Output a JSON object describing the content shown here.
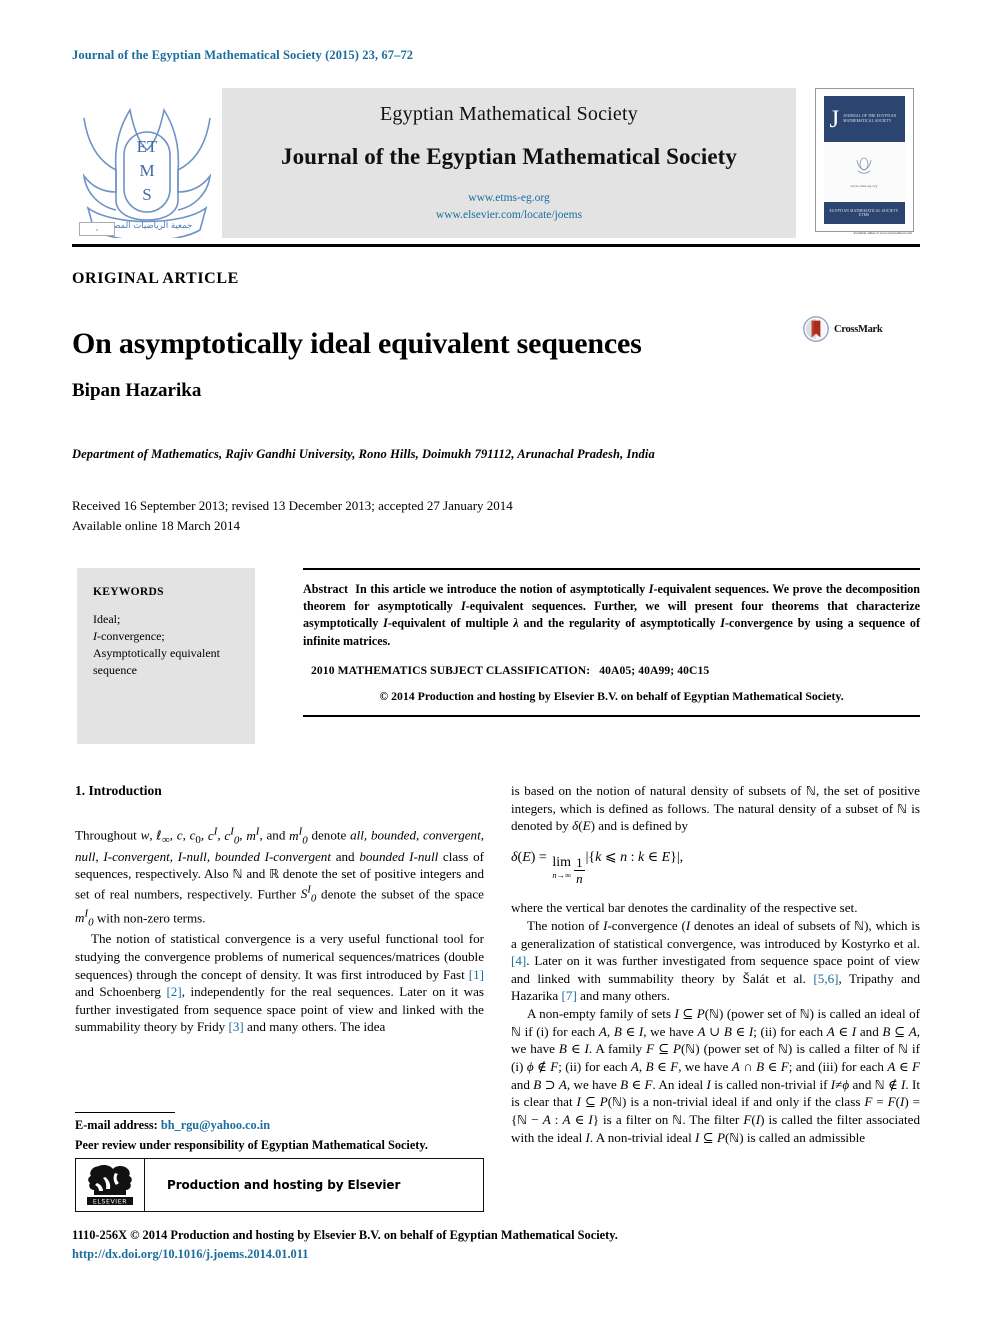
{
  "running_head": "Journal of the Egyptian Mathematical Society (2015) 23, 67–72",
  "masthead": {
    "society_logo_text": "ETMS",
    "society_logo_arabic": "جمعية الرياضيات المصرية",
    "line1": "Egyptian Mathematical Society",
    "line2": "Journal of the Egyptian Mathematical Society",
    "url1": "www.etms-eg.org",
    "url2": "www.elsevier.com/locate/joems",
    "cover": {
      "initial": "J",
      "title_lines": "JOURNAL OF THE EGYPTIAN MATHEMATICAL SOCIETY",
      "subtitle": "www.etms-eg.org",
      "band": "EGYPTIAN MATHEMATICAL SOCIETY",
      "band2": "ETMS",
      "foot_box": "≡",
      "foot_text": "Available online at www.sciencedirect.com"
    }
  },
  "article": {
    "type": "ORIGINAL ARTICLE",
    "title": "On asymptotically ideal equivalent sequences",
    "crossmark_label": "CrossMark",
    "author": "Bipan Hazarika",
    "affiliation": "Department of Mathematics, Rajiv Gandhi University, Rono Hills, Doimukh 791112, Arunachal Pradesh, India",
    "received_line": "Received 16 September 2013; revised 13 December 2013; accepted 27 January 2014",
    "available_line": "Available online 18 March 2014"
  },
  "keywords": {
    "heading": "KEYWORDS",
    "items": [
      "Ideal;",
      "I-convergence;",
      "Asymptotically equivalent",
      "sequence"
    ],
    "italic_prefix": "I"
  },
  "abstract": {
    "label": "Abstract",
    "text": "In this article we introduce the notion of asymptotically I-equivalent sequences. We prove the decomposition theorem for asymptotically I-equivalent sequences. Further, we will present four theorems that characterize asymptotically I-equivalent of multiple λ and the regularity of asymptotically I-convergence by using a sequence of infinite matrices.",
    "msc_label": "2010 MATHEMATICS SUBJECT CLASSIFICATION:",
    "msc_codes": "40A05; 40A99; 40C15",
    "copyright": "© 2014 Production and hosting by Elsevier B.V. on behalf of Egyptian Mathematical Society."
  },
  "body": {
    "section_heading": "1. Introduction",
    "left_p1_a": "Throughout",
    "left_p1_b": "and",
    "left_p1_c": "denote",
    "left_p1_terms": "all, bounded, convergent, null, I-convergent, I-null, bounded I-convergent",
    "left_p1_d": "and",
    "left_p1_terms2": "bounded I-null",
    "left_p1_e": "class of sequences, respectively. Also",
    "left_p1_f": "and",
    "left_p1_g": "denote the set of positive integers and set of real numbers, respectively. Further",
    "left_p1_h": "denote the subset of the space",
    "left_p1_i": "with non-zero terms.",
    "left_p2": "The notion of statistical convergence is a very useful functional tool for studying the convergence problems of numerical sequences/matrices (double sequences) through the concept of density. It was first introduced by Fast [1] and Schoenberg [2], independently for the real sequences. Later on it was further investigated from sequence space point of view and linked with the summability theory by Fridy [3] and many others. The idea",
    "right_p1": "is based on the notion of natural density of subsets of ℕ, the set of positive integers, which is defined as follows. The natural density of a subset of ℕ is denoted by δ(E) and is defined by",
    "right_eq": "δ(E) = lim (1/n) |{k ⩽ n : k ∈ E}|,",
    "right_p2": "where the vertical bar denotes the cardinality of the respective set.",
    "right_p3": "The notion of I-convergence (I denotes an ideal of subsets of ℕ), which is a generalization of statistical convergence, was introduced by Kostyrko et al. [4]. Later on it was further investigated from sequence space point of view and linked with summability theory by Šalát et al. [5,6], Tripathy and Hazarika [7] and many others.",
    "right_p4": "A non-empty family of sets I ⊆ P(ℕ) (power set of ℕ) is called an ideal of ℕ if (i) for each A, B ∈ I, we have A ∪ B ∈ I; (ii) for each A ∈ I and B ⊆ A, we have B ∈ I. A family F ⊆ P(ℕ) (power set of ℕ) is called a filter of ℕ if (i) ϕ ∉ F; (ii) for each A, B ∈ F, we have A ∩ B ∈ F; and (iii) for each A ∈ F and B ⊃ A, we have B ∈ F. An ideal I is called non-trivial if I ≠ ϕ and ℕ ∉ I. It is clear that I ⊆ P(ℕ) is a non-trivial ideal if and only if the class F = F(I) = {ℕ − A : A ∈ I} is a filter on ℕ. The filter F(I) is called the filter associated with the ideal I. A non-trivial ideal I ⊆ P(ℕ) is called an admissible",
    "refs": [
      "1",
      "2",
      "3",
      "4",
      "5,6",
      "7"
    ]
  },
  "footnote": {
    "email_label": "E-mail address:",
    "email": "bh_rgu@yahoo.co.in",
    "peer_review": "Peer review under responsibility of Egyptian Mathematical Society.",
    "elsevier_label": "Production and hosting by Elsevier",
    "elsevier_wordmark": "ELSEVIER",
    "issn_line": "1110-256X © 2014 Production and hosting by Elsevier B.V. on behalf of Egyptian Mathematical Society.",
    "doi": "http://dx.doi.org/10.1016/j.joems.2014.01.011"
  },
  "colors": {
    "link": "#1a6d9e",
    "panel": "#e3e3e3",
    "cover_blue": "#2b4570"
  }
}
